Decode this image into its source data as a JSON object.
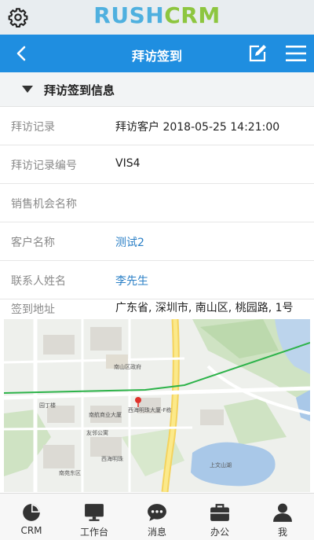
{
  "app": {
    "logo_part1": "RUSH",
    "logo_part2": "CRM"
  },
  "navbar": {
    "title": "拜访签到"
  },
  "section": {
    "title": "拜访签到信息"
  },
  "fields": [
    {
      "label": "拜访记录",
      "value": "拜访客户 2018-05-25 14:21:00"
    },
    {
      "label": "拜访记录编号",
      "value": "VIS4"
    },
    {
      "label": "销售机会名称",
      "value": ""
    },
    {
      "label": "客户名称",
      "value": "测试2"
    },
    {
      "label": "联系人姓名",
      "value": "李先生"
    },
    {
      "label": "签到地址",
      "value": "广东省, 深圳市, 南山区, 桃园路, 1号"
    }
  ],
  "map": {
    "labels": [
      "南山区政府",
      "南航商业大厦",
      "西海明珠大厦-F栋",
      "友邻公寓",
      "西海明珠",
      "园丁楼",
      "南苑东区",
      "上文山湖"
    ]
  },
  "tabbar": {
    "tabs": [
      {
        "label": "CRM",
        "icon": "pie-chart-icon"
      },
      {
        "label": "工作台",
        "icon": "monitor-icon"
      },
      {
        "label": "消息",
        "icon": "chat-bubble-icon"
      },
      {
        "label": "办公",
        "icon": "briefcase-icon"
      },
      {
        "label": "我",
        "icon": "person-icon"
      }
    ]
  },
  "colors": {
    "navbar": "#1f8ee0",
    "logo_rush": "#4fb0df",
    "logo_crm": "#8dc63f",
    "link": "#2a7fc6"
  }
}
